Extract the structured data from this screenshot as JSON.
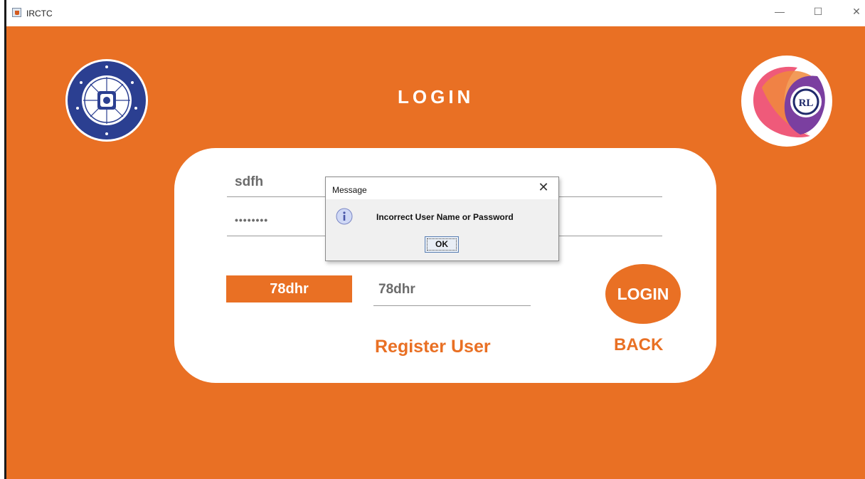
{
  "window": {
    "title": "IRCTC",
    "minimize_glyph": "—",
    "maximize_glyph": "☐",
    "close_glyph": "✕"
  },
  "page": {
    "heading": "LOGIN"
  },
  "form": {
    "username_value": "sdfh",
    "password_mask": "••••••••",
    "captcha_code": "78dhr",
    "captcha_input_value": "78dhr",
    "login_button": "LOGIN",
    "register_link": "Register User",
    "back_link": "BACK"
  },
  "dialog": {
    "title": "Message",
    "close_glyph": "✕",
    "message": "Incorrect User Name or Password",
    "ok_label": "OK"
  },
  "logos": {
    "left": "indian-railways-logo",
    "right": "irctc-logo"
  },
  "colors": {
    "accent": "#e97024",
    "card": "#ffffff",
    "title_text": "#ffffff"
  }
}
